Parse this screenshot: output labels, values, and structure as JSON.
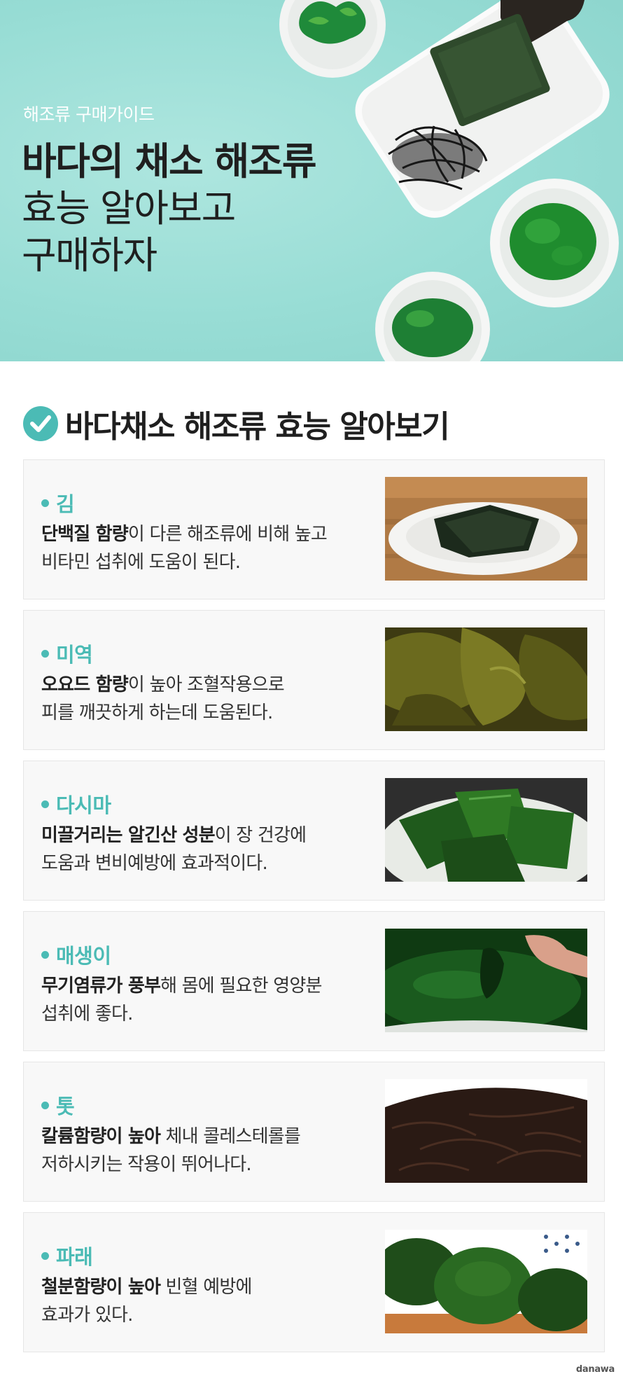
{
  "hero": {
    "subtitle": "해조류 구매가이드",
    "title_line1": "바다의 채소 해조류",
    "title_line2": "효능 알아보고",
    "title_line3": "구매하자"
  },
  "section": {
    "title": "바다채소 해조류 효능 알아보기",
    "icon": "check-circle-icon",
    "accent_color": "#4bbbb5"
  },
  "items": [
    {
      "name": "김",
      "bold": "단백질 함량",
      "rest1": "이 다른 해조류에 비해 높고",
      "line2": "비타민 섭취에 도움이 된다."
    },
    {
      "name": "미역",
      "bold": "오요드 함량",
      "rest1": "이 높아 조혈작용으로",
      "line2": "피를 깨끗하게 하는데 도움된다."
    },
    {
      "name": "다시마",
      "bold": "미끌거리는 알긴산 성분",
      "rest1": "이 장 건강에",
      "line2": "도움과 변비예방에 효과적이다."
    },
    {
      "name": "매생이",
      "bold": "무기염류가 풍부",
      "rest1": "해 몸에 필요한 영양분",
      "line2": "섭취에 좋다."
    },
    {
      "name": "톳",
      "bold": "칼륨함량이 높아",
      "rest1": " 체내 콜레스테롤를",
      "line2": "저하시키는 작용이 뛰어나다."
    },
    {
      "name": "파래",
      "bold": "철분함량이 높아",
      "rest1": " 빈혈 예방에",
      "line2": "효과가 있다."
    }
  ],
  "footer": {
    "brand": "danawa"
  }
}
